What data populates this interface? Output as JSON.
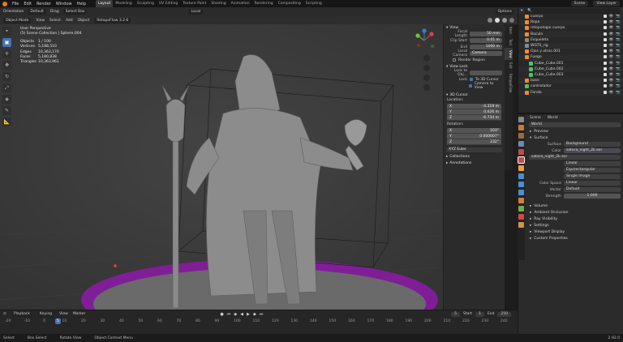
{
  "topbar": {
    "menus": [
      "File",
      "Edit",
      "Render",
      "Window",
      "Help"
    ],
    "workspaces": [
      "Layout",
      "Modeling",
      "Sculpting",
      "UV Editing",
      "Texture Paint",
      "Shading",
      "Animation",
      "Rendering",
      "Compositing",
      "Scripting"
    ],
    "active_workspace": "Layout",
    "scene": "Scene",
    "view_layer": "View Layer"
  },
  "tool_header": {
    "orientation_label": "Orientation",
    "orientation_value": "Default",
    "drag_label": "Drag",
    "drag_value": "Select Box",
    "transform": "Local",
    "options": "Options"
  },
  "viewport_header": {
    "mode": "Object Mode",
    "menus": [
      "View",
      "Select",
      "Add",
      "Object"
    ],
    "addon": "RetopoFlow 3.2.6"
  },
  "viewport": {
    "title": "User Perspective",
    "collection": "(5) Scene Collection | Sphere.004",
    "stats": [
      {
        "k": "Objects",
        "v": "1 / 100"
      },
      {
        "k": "Vertices",
        "v": "5,188,510"
      },
      {
        "k": "Edges",
        "v": "10,363,170"
      },
      {
        "k": "Faces",
        "v": "5,180,838"
      },
      {
        "k": "Triangles",
        "v": "10,363,961"
      }
    ]
  },
  "npanel": {
    "view_title": "View",
    "focal_label": "Focal Length",
    "focal": "50 mm",
    "clip_start_label": "Clip Start",
    "clip_start": "0.01 m",
    "end_label": "End",
    "end": "1000 m",
    "local_camera": "Local Camera",
    "camera": "Camera",
    "render_region": "Render Region",
    "view_lock": "View Lock",
    "lock_to_obj": "Lock to Obj...",
    "lock": "Lock",
    "to_3d_cursor": "To 3D Cursor",
    "camera_to_view": "Camera to View",
    "cursor_title": "3D Cursor",
    "location": "Location:",
    "loc": [
      {
        "a": "X",
        "v": "-4.319 m"
      },
      {
        "a": "Y",
        "v": "0.626 m"
      },
      {
        "a": "Z",
        "v": "-6.734 m"
      }
    ],
    "rotation": "Rotation:",
    "rot": [
      {
        "a": "X",
        "v": "103°"
      },
      {
        "a": "Y",
        "v": "0.000007°"
      },
      {
        "a": "Z",
        "v": "232°"
      }
    ],
    "euler": "XYZ Euler",
    "collections": "Collections",
    "annotations": "Annotations",
    "tabs": [
      "Item",
      "Tool",
      "View",
      "Edit",
      "RetopoFlow"
    ]
  },
  "outliner": {
    "items": [
      {
        "name": "cuerpo",
        "ind": 1,
        "color": "#f08d2d"
      },
      {
        "name": "Ropa",
        "ind": 1,
        "color": "#f08d2d"
      },
      {
        "name": "retopologia cuerpo",
        "ind": 1,
        "color": "#f08d2d"
      },
      {
        "name": "Baculo",
        "ind": 1,
        "color": "#f08d2d"
      },
      {
        "name": "Esqueleto",
        "ind": 1,
        "color": "#8a8a8a"
      },
      {
        "name": "WGTS_rig",
        "ind": 1,
        "color": "#8a8a8a"
      },
      {
        "name": "Ojos y otros.001",
        "ind": 1,
        "color": "#f08d2d"
      },
      {
        "name": "Fuego",
        "ind": 1,
        "color": "#f08d2d"
      },
      {
        "name": "Cube_Cube.001",
        "ind": 2,
        "color": "#4bc26a"
      },
      {
        "name": "Cube_Cube.002",
        "ind": 2,
        "color": "#4bc26a"
      },
      {
        "name": "Cube_Cube.003",
        "ind": 2,
        "color": "#4bc26a"
      },
      {
        "name": "base",
        "ind": 1,
        "color": "#f08d2d"
      },
      {
        "name": "controlador",
        "ind": 1,
        "color": "#4bc26a"
      },
      {
        "name": "Fondo",
        "ind": 1,
        "color": "#f08d2d"
      }
    ]
  },
  "props": {
    "scene": "Scene",
    "world_label": "World",
    "world": "World",
    "preview": "Preview",
    "surface": "Surface",
    "surface_label": "Surface",
    "surface_value": "Background",
    "color_label": "Color",
    "color_value": "satara_night_2k.exr",
    "image": "satara_night_2k.exr",
    "linear": "Linear",
    "equirect": "Equirectangular",
    "single": "Single Image",
    "colorspace_label": "Color Space",
    "colorspace": "Linear",
    "vector_label": "Vector",
    "vector": "Default",
    "strength_label": "Strength",
    "strength": "1.000",
    "sections": [
      "Volume",
      "Ambient Occlusion",
      "Ray Visibility",
      "Settings",
      "Viewport Display",
      "Custom Properties"
    ]
  },
  "timeline": {
    "menus": [
      "Playback",
      "Keying",
      "View",
      "Marker"
    ],
    "current": "5",
    "start_label": "Start",
    "start": "1",
    "end_label": "End",
    "end": "250",
    "ticks": [
      "-20",
      "-10",
      "0",
      "10",
      "20",
      "30",
      "40",
      "50",
      "60",
      "70",
      "80",
      "90",
      "100",
      "110",
      "120",
      "130",
      "140",
      "150",
      "160",
      "170",
      "180",
      "190",
      "200",
      "210",
      "220",
      "230",
      "240"
    ]
  },
  "status": {
    "items": [
      "Select",
      "Box Select",
      "Rotate View",
      "Object Context Menu"
    ],
    "version": "2.92.0"
  }
}
